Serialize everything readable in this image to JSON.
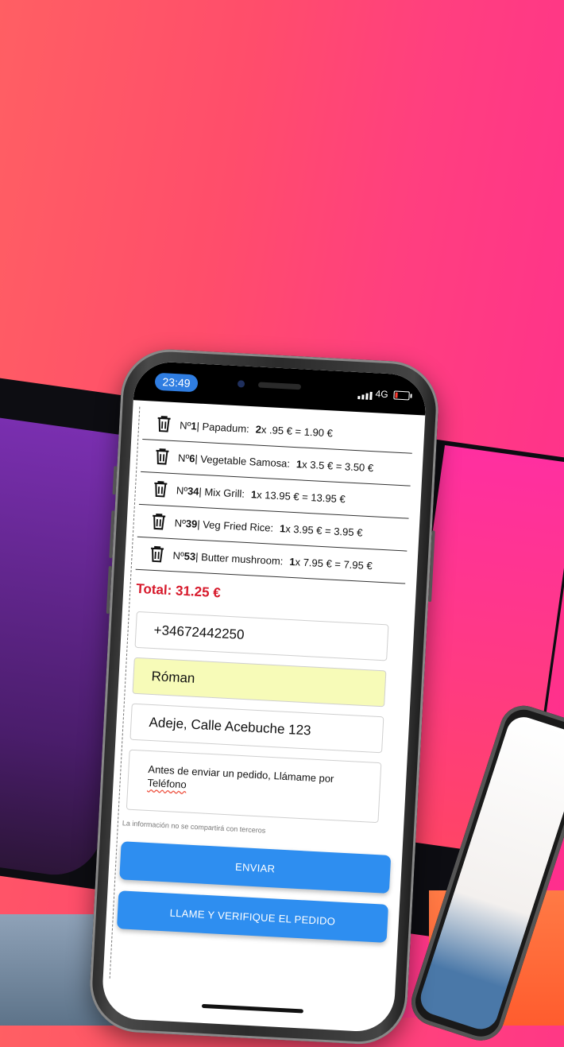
{
  "status_bar": {
    "time": "23:49",
    "network": "4G",
    "signal_icon": "signal-bars-icon",
    "battery_icon": "battery-low-icon"
  },
  "order_items": [
    {
      "num_prefix": "Nº",
      "num": "1",
      "name": " | Papadum:",
      "qty": "2",
      "rest": " x .95 € = 1.90 €"
    },
    {
      "num_prefix": "Nº",
      "num": "6",
      "name": " | Vegetable Samosa:",
      "qty": "1",
      "rest": " x 3.5 € = 3.50 €"
    },
    {
      "num_prefix": "Nº",
      "num": "34",
      "name": " | Mix Grill:",
      "qty": "1",
      "rest": " x 13.95 € = 13.95 €"
    },
    {
      "num_prefix": "Nº",
      "num": "39",
      "name": " | Veg Fried Rice:",
      "qty": "1",
      "rest": " x 3.95 € = 3.95 €"
    },
    {
      "num_prefix": "Nº",
      "num": "53",
      "name": " | Butter mushroom:",
      "qty": "1",
      "rest": " x 7.95 € = 7.95 €"
    }
  ],
  "total": "Total: 31.25 €",
  "form": {
    "phone": "+34672442250",
    "name": "Róman",
    "address": "Adeje, Calle Acebuche 123",
    "notes_line1": "Antes de enviar un pedido, Llámame por",
    "notes_line2": "Teléfono",
    "privacy_note": "La información no se compartirá con terceros"
  },
  "buttons": {
    "send": "ENVIAR",
    "call_verify": "LLAME Y VERIFIQUE EL PEDIDO"
  },
  "colors": {
    "accent_blue": "#2e8ef0",
    "total_red": "#d7192b",
    "name_field_bg": "#f7fbb8"
  }
}
